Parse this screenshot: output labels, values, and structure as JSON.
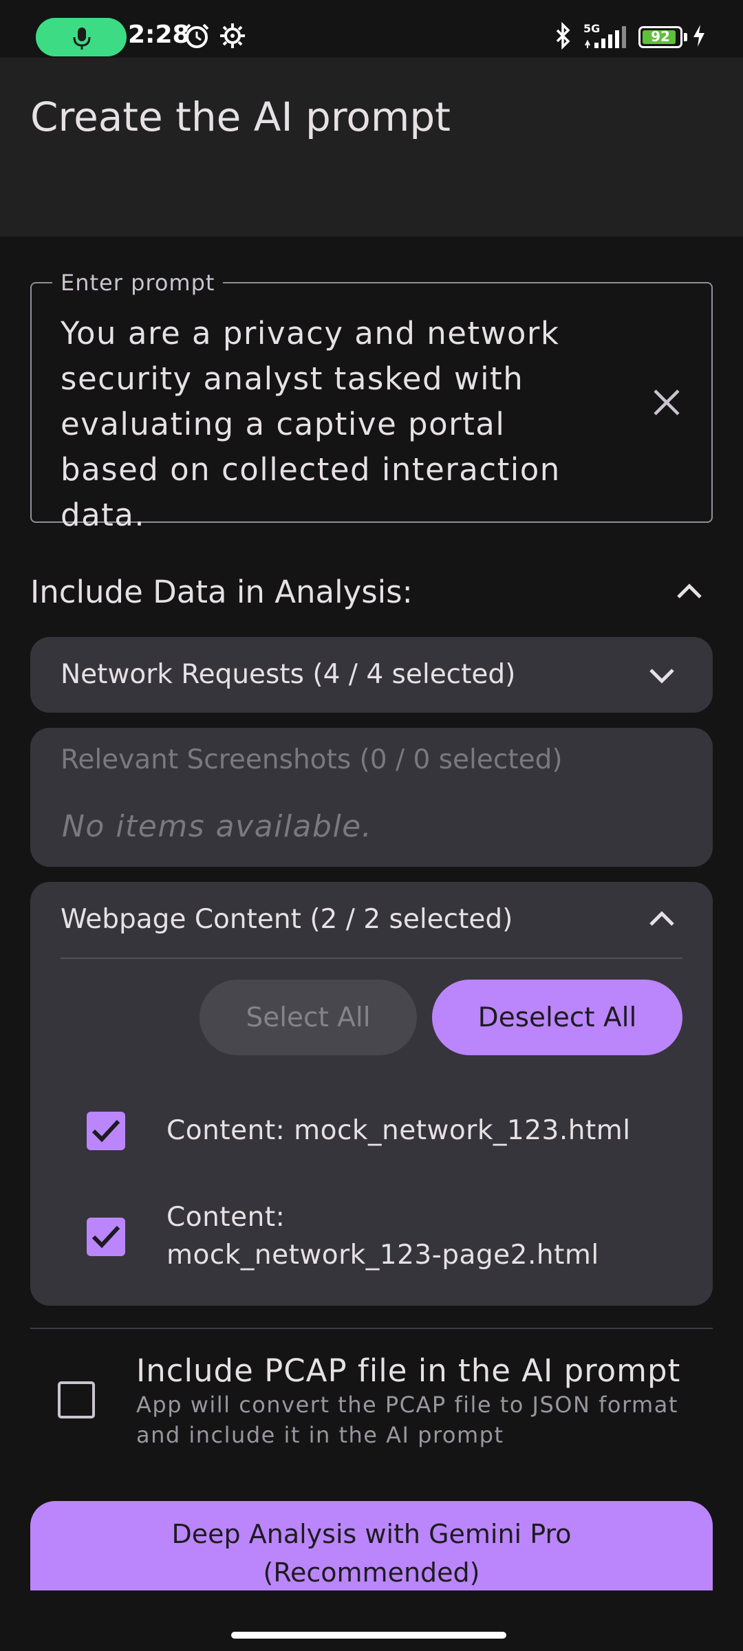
{
  "status_bar": {
    "time": "2:28",
    "battery_level": "92",
    "battery_fraction": 0.92,
    "network_label": "5G",
    "icons": [
      "mic-icon",
      "alarm-icon",
      "settings-gear-icon",
      "bluetooth-icon",
      "signal-icon",
      "battery-icon",
      "charging-bolt-icon"
    ]
  },
  "header": {
    "title": "Create the AI prompt"
  },
  "prompt": {
    "label": "Enter prompt",
    "value": "You are a privacy and network security analyst tasked with evaluating a captive portal based on collected interaction data."
  },
  "include_section": {
    "title": "Include Data in Analysis:",
    "expanded": true
  },
  "cards": {
    "network_requests": {
      "title": "Network Requests (4 / 4 selected)",
      "expanded": false
    },
    "screenshots": {
      "title": "Relevant Screenshots (0 / 0 selected)",
      "empty_text": "No items available."
    },
    "webpage_content": {
      "title": "Webpage Content (2 / 2 selected)",
      "expanded": true,
      "select_all_label": "Select All",
      "deselect_all_label": "Deselect All",
      "items": [
        {
          "label": "Content: mock_network_123.html",
          "checked": true
        },
        {
          "label_line1": "Content:",
          "label_line2": "mock_network_123-page2.html",
          "checked": true
        }
      ]
    }
  },
  "pcap": {
    "checked": false,
    "title": "Include PCAP file in the AI prompt",
    "description": "App will convert the PCAP file to JSON format and include it in the AI prompt"
  },
  "cta": {
    "line1": "Deep Analysis with Gemini Pro",
    "line2": "(Recommended)"
  },
  "colors": {
    "accent": "#bb86fc",
    "background": "#141414",
    "card": "#36353b",
    "app_bar": "#212121",
    "mic_pill": "#3ddc84"
  }
}
